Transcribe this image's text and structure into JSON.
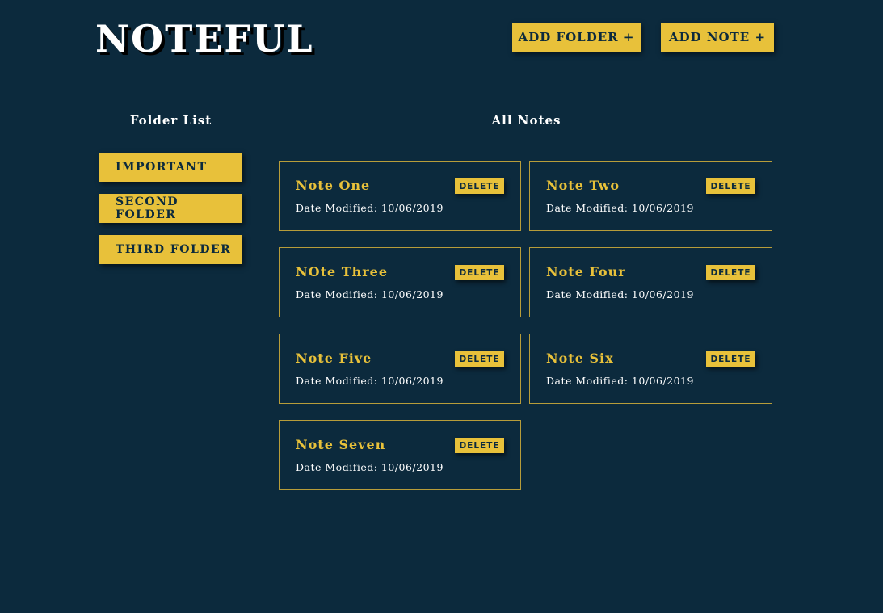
{
  "app": {
    "title": "NOTEFUL"
  },
  "header": {
    "add_folder_label": "ADD FOLDER +",
    "add_note_label": "ADD NOTE +"
  },
  "sidebar": {
    "heading": "Folder List",
    "folders": [
      {
        "label": "IMPORTANT"
      },
      {
        "label": "SECOND FOLDER"
      },
      {
        "label": "THIRD FOLDER"
      }
    ]
  },
  "main": {
    "heading": "All Notes",
    "delete_label": "DELETE",
    "date_prefix": "Date Modified:",
    "notes": [
      {
        "title": "Note One",
        "date": "10/06/2019"
      },
      {
        "title": "Note Two",
        "date": "10/06/2019"
      },
      {
        "title": "NOte Three",
        "date": "10/06/2019"
      },
      {
        "title": "Note Four",
        "date": "10/06/2019"
      },
      {
        "title": "Note Five",
        "date": "10/06/2019"
      },
      {
        "title": "Note Six",
        "date": "10/06/2019"
      },
      {
        "title": "Note Seven",
        "date": "10/06/2019"
      }
    ]
  },
  "colors": {
    "background": "#0c2a3d",
    "accent": "#e8c13a",
    "text": "#ffffff",
    "rule": "#b89d3a"
  }
}
